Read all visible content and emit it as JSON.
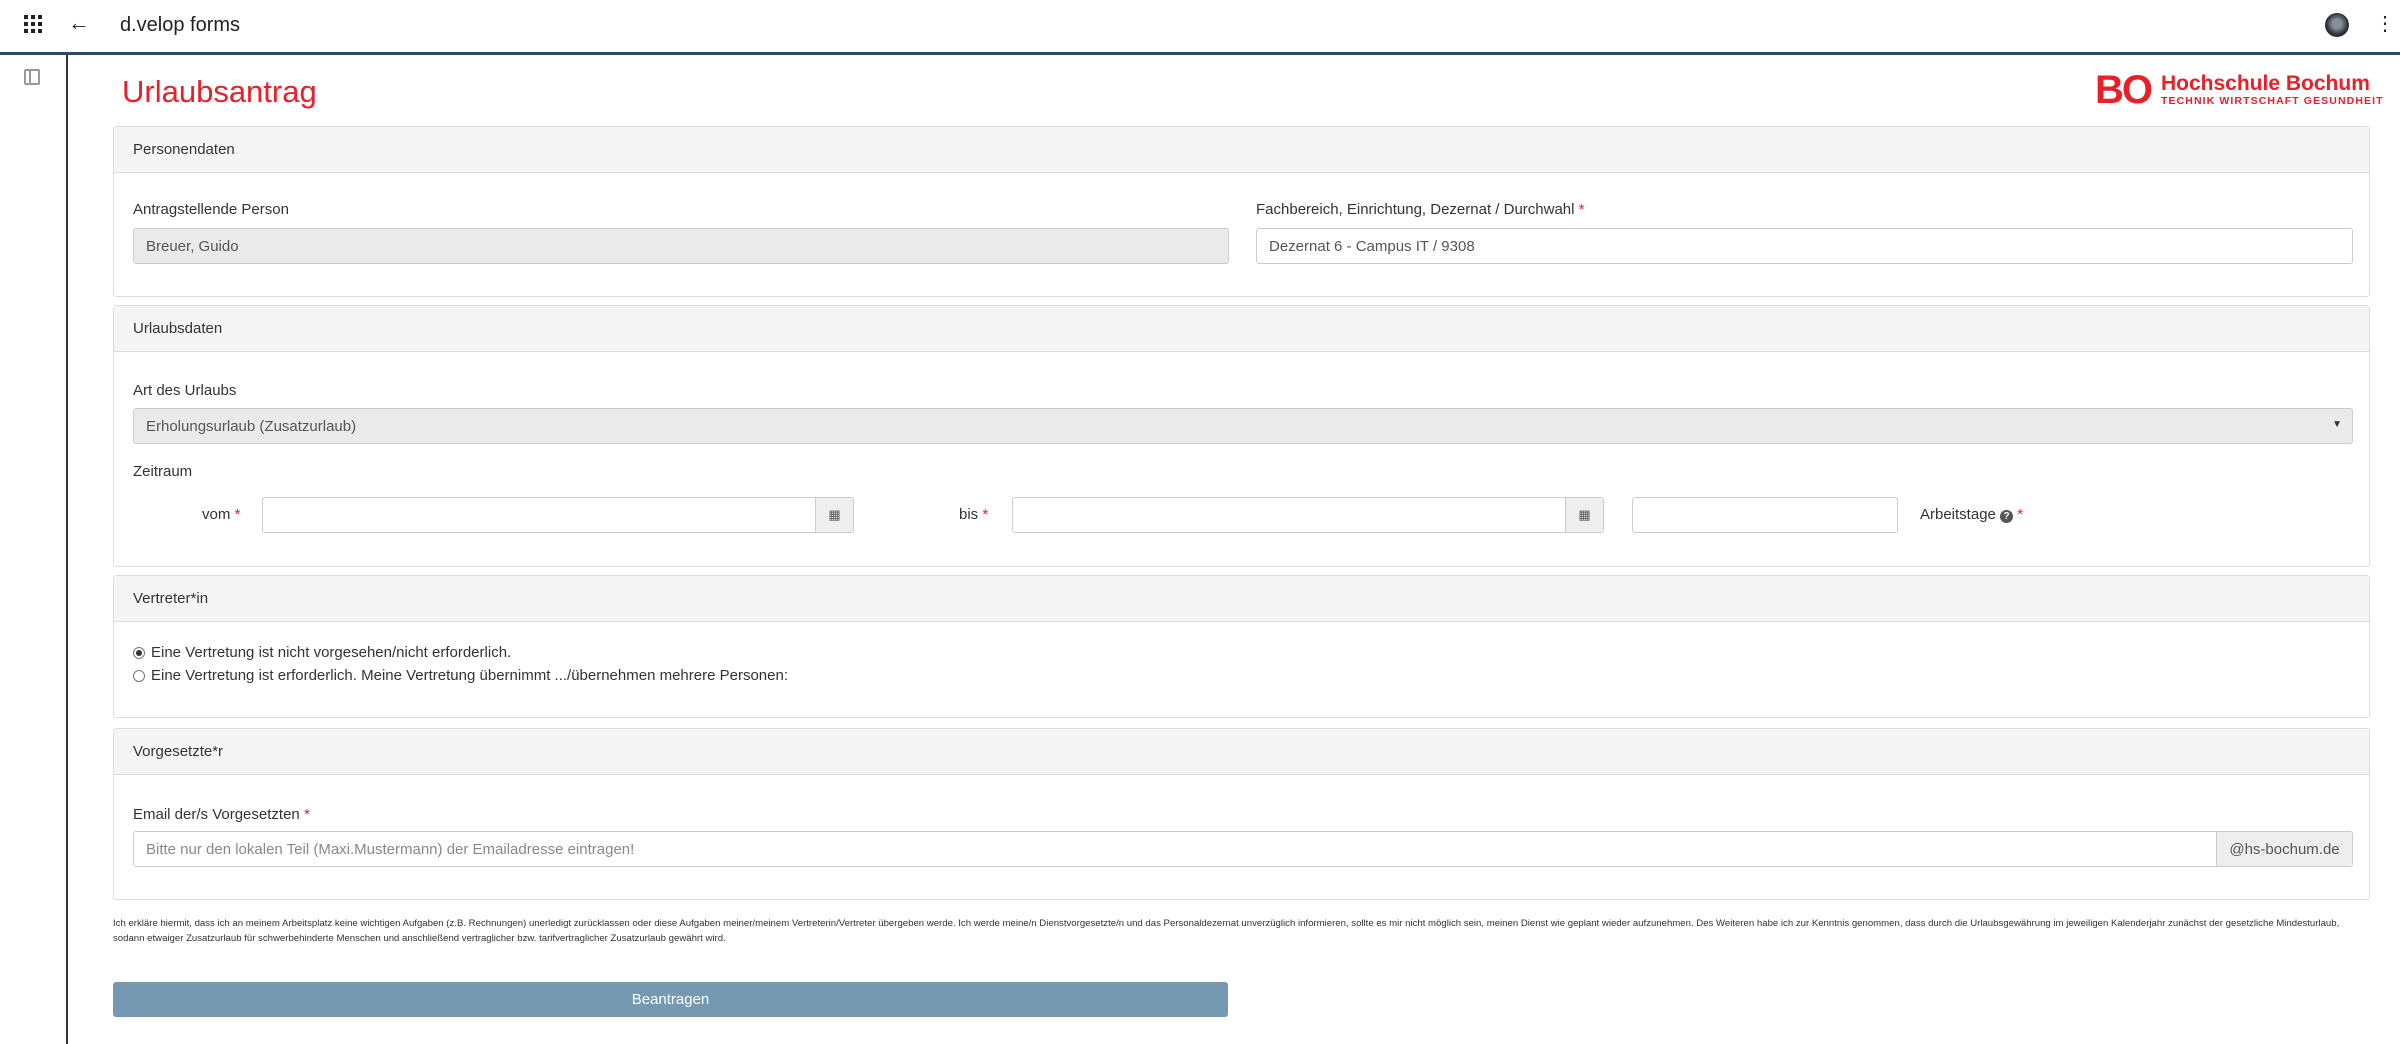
{
  "topbar": {
    "app_title": "d.velop forms"
  },
  "form": {
    "title": "Urlaubsantrag",
    "logo": {
      "mark": "BO",
      "name": "Hochschule Bochum",
      "tagline": "TECHNIK WIRTSCHAFT GESUNDHEIT"
    },
    "personendaten": {
      "header": "Personendaten",
      "person_label": "Antragstellende Person",
      "person_value": "Breuer, Guido",
      "fachbereich_label": "Fachbereich, Einrichtung, Dezernat / Durchwahl",
      "fachbereich_value": "Dezernat 6 - Campus IT /  9308"
    },
    "urlaubsdaten": {
      "header": "Urlaubsdaten",
      "art_label": "Art des Urlaubs",
      "art_value": "Erholungsurlaub (Zusatzurlaub)",
      "zeitraum_label": "Zeitraum",
      "vom_label": "vom",
      "bis_label": "bis",
      "arbeitstage_label": "Arbeitstage"
    },
    "vertreter": {
      "header": "Vertreter*in",
      "options": [
        "Eine Vertretung ist nicht vorgesehen/nicht erforderlich.",
        "Eine Vertretung ist erforderlich. Meine Vertretung übernimmt .../übernehmen mehrere Personen:"
      ],
      "selected": 0
    },
    "vorgesetzte": {
      "header": "Vorgesetzte*r",
      "email_label": "Email der/s Vorgesetzten",
      "email_placeholder": "Bitte nur den lokalen Teil (Maxi.Mustermann) der Emailadresse eintragen!",
      "email_domain": "@hs-bochum.de"
    },
    "required_mark": "*",
    "disclaimer": "Ich erkläre hiermit, dass ich an meinem Arbeitsplatz keine wichtigen Aufgaben (z.B. Rechnungen) unerledigt zurücklassen oder diese Aufgaben meiner/meinem Vertreterin/Vertreter übergeben werde. Ich werde meine/n Dienstvorgesetzte/n und das Personaldezernat unverzüglich informieren, sollte es mir nicht möglich sein, meinen Dienst wie geplant wieder aufzunehmen. Des Weiteren habe ich zur Kenntnis genommen, dass durch die Urlaubsgewährung im jeweiligen Kalenderjahr zunächst der gesetzliche Mindesturlaub, sodann etwaiger Zusatzurlaub für schwerbehinderte Menschen und anschließend vertraglicher bzw. tarifvertraglicher Zusatzurlaub gewährt wird.",
    "submit_label": "Beantragen"
  }
}
